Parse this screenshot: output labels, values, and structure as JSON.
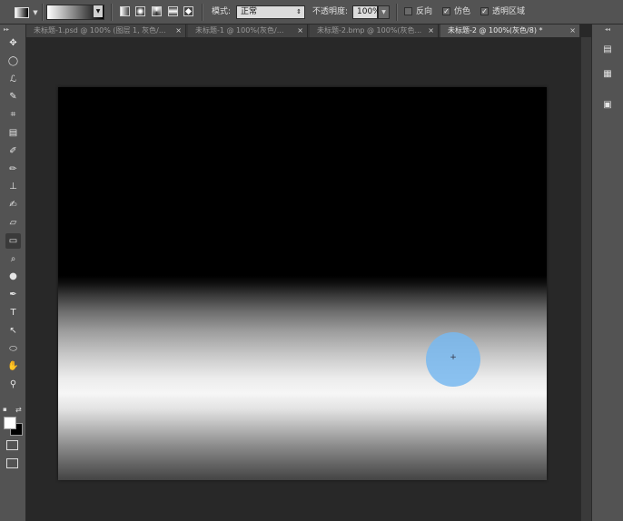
{
  "options_bar": {
    "tool_preset_icon": "gradient-tool-icon",
    "mode_label": "模式:",
    "mode_value": "正常",
    "opacity_label": "不透明度:",
    "opacity_value": "100%",
    "reverse_label": "反向",
    "reverse_checked": false,
    "dither_label": "仿色",
    "dither_checked": true,
    "transparency_label": "透明区域",
    "transparency_checked": true,
    "gradient_modes": [
      "linear",
      "radial",
      "angle",
      "reflected",
      "diamond"
    ]
  },
  "tabs": [
    {
      "label": "未标题-1.psd @ 100% (图层 1, 灰色/...",
      "active": false
    },
    {
      "label": "未标题-1 @ 100%(灰色/...",
      "active": false
    },
    {
      "label": "未标题-2.bmp @ 100%(灰色...",
      "active": false
    },
    {
      "label": "未标题-2 @ 100%(灰色/8) *",
      "active": true
    }
  ],
  "tab_close_glyph": "×",
  "tools": [
    {
      "name": "move-tool-icon",
      "glyph": "✥"
    },
    {
      "name": "marquee-tool-icon",
      "glyph": "◯"
    },
    {
      "name": "lasso-tool-icon",
      "glyph": "ℒ"
    },
    {
      "name": "quick-select-tool-icon",
      "glyph": "✎"
    },
    {
      "name": "crop-tool-icon",
      "glyph": "⌗"
    },
    {
      "name": "eyedropper-tool-icon",
      "glyph": "▤"
    },
    {
      "name": "healing-brush-tool-icon",
      "glyph": "✐"
    },
    {
      "name": "brush-tool-icon",
      "glyph": "✏"
    },
    {
      "name": "clone-stamp-tool-icon",
      "glyph": "⊥"
    },
    {
      "name": "history-brush-tool-icon",
      "glyph": "✍"
    },
    {
      "name": "eraser-tool-icon",
      "glyph": "▱"
    },
    {
      "name": "gradient-tool-icon",
      "glyph": "▭"
    },
    {
      "name": "blur-tool-icon",
      "glyph": "⌕"
    },
    {
      "name": "dodge-tool-icon",
      "glyph": "●"
    },
    {
      "name": "pen-tool-icon",
      "glyph": "✒"
    },
    {
      "name": "type-tool-icon",
      "glyph": "T"
    },
    {
      "name": "path-select-tool-icon",
      "glyph": "↖"
    },
    {
      "name": "ellipse-shape-tool-icon",
      "glyph": "⬭"
    },
    {
      "name": "hand-tool-icon",
      "glyph": "✋"
    },
    {
      "name": "zoom-tool-icon",
      "glyph": "⚲"
    }
  ],
  "colors": {
    "foreground": "#ffffff",
    "background": "#000000",
    "brush_cursor": "#78b9f0"
  },
  "right_panel_icons": [
    "history-panel-icon",
    "properties-panel-icon",
    "layers-panel-icon"
  ]
}
